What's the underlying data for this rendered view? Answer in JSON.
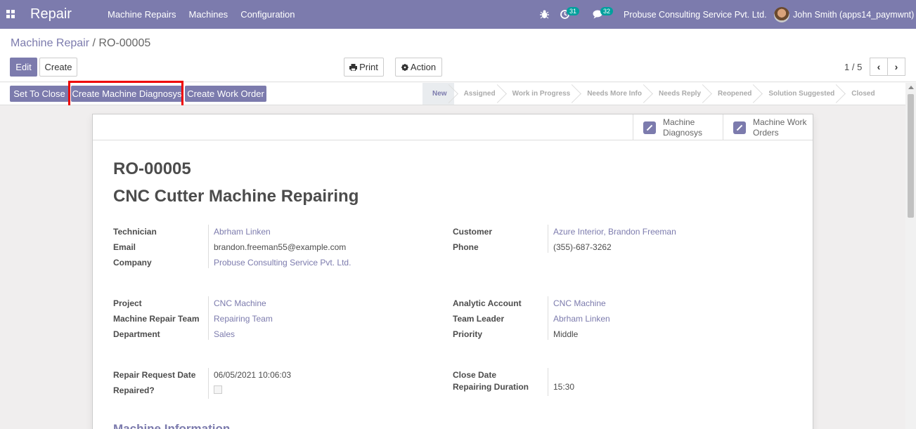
{
  "navbar": {
    "app_name": "Repair",
    "menu": [
      "Machine Repairs",
      "Machines",
      "Configuration"
    ],
    "activity_count": "31",
    "messages_count": "32",
    "company": "Probuse Consulting Service Pvt. Ltd.",
    "user": "John Smith (apps14_paymwnt)"
  },
  "breadcrumb": {
    "parent": "Machine Repair",
    "separator": "/",
    "current": "RO-00005"
  },
  "toolbar": {
    "edit": "Edit",
    "create": "Create",
    "print": "Print",
    "action": "Action",
    "pager": "1 / 5"
  },
  "statusbar": {
    "buttons": [
      "Set To Close",
      "Create Machine Diagnosys",
      "Create Work Order"
    ],
    "stages": [
      "New",
      "Assigned",
      "Work in Progress",
      "Needs More Info",
      "Needs Reply",
      "Reopened",
      "Solution Suggested",
      "Closed"
    ],
    "active_stage": "New"
  },
  "smart_buttons": [
    {
      "line1": "Machine",
      "line2": "Diagnosys"
    },
    {
      "line1": "Machine Work",
      "line2": "Orders"
    }
  ],
  "record": {
    "reference": "RO-00005",
    "title": "CNC Cutter Machine Repairing",
    "technician_label": "Technician",
    "technician": "Abrham Linken",
    "email_label": "Email",
    "email": "brandon.freeman55@example.com",
    "company_label": "Company",
    "company": "Probuse Consulting Service Pvt. Ltd.",
    "customer_label": "Customer",
    "customer": "Azure Interior, Brandon Freeman",
    "phone_label": "Phone",
    "phone": "(355)-687-3262",
    "project_label": "Project",
    "project": "CNC Machine",
    "team_label": "Machine Repair Team",
    "team": "Repairing Team",
    "department_label": "Department",
    "department": "Sales",
    "analytic_label": "Analytic Account",
    "analytic": "CNC Machine",
    "leader_label": "Team Leader",
    "leader": "Abrham Linken",
    "priority_label": "Priority",
    "priority": "Middle",
    "request_date_label": "Repair Request Date",
    "request_date": "06/05/2021 10:06:03",
    "repaired_label": "Repaired?",
    "close_date_label": "Close Date",
    "duration_label": "Repairing Duration",
    "duration": "15:30",
    "section_title": "Machine Information"
  },
  "colors": {
    "brand": "#7c7bad",
    "highlight": "#ee0000"
  }
}
